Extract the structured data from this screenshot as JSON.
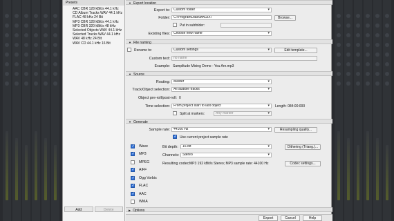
{
  "presets": {
    "title": "Presets",
    "items": [
      "AAC CBR 128 kBit/s 44.1 kHz",
      "CD Album Tracks WAV 44.1 kHz",
      "FLAC 48 kHz 24 Bit",
      "MP3 CBR 128 kBit/s 44.1 kHz",
      "MP3 CBR 320 kBit/s 48 kHz",
      "Selected Objects WAV 44.1 kHz",
      "Selected Tracks WAV 44.1 kHz",
      "WAV 48 kHz 24 Bit",
      "WAV CD 44.1 kHz 16 Bit"
    ],
    "add_label": "Add",
    "delete_label": "Delete"
  },
  "export_location": {
    "title": "Export location",
    "export_to_label": "Export to:",
    "export_to_value": "Custom folder",
    "folder_label": "Folder:",
    "folder_value": "C:\\ProgramData\\MAGIX\\",
    "browse_label": "Browse...",
    "subfolder_label": "Put in subfolder:",
    "existing_label": "Existing files:",
    "existing_value": "Choose new name"
  },
  "file_naming": {
    "title": "File naming",
    "rename_label": "Rename to:",
    "rename_value": "Custom settings",
    "edit_template_label": "Edit template...",
    "custom_text_label": "Custom text:",
    "custom_text_placeholder": "no name",
    "example_label": "Example:",
    "example_value": "Samplitude Mixing Demo - You Are.mp3"
  },
  "source": {
    "title": "Source",
    "routing_label": "Routing:",
    "routing_value": "Master",
    "track_label": "Track/Object selection:",
    "track_value": "All audible tracks",
    "preroll_label": "Object pre-roll/post-roll:",
    "preroll_value": "0",
    "time_label": "Time selection:",
    "time_value": "From project start to last object",
    "length_label": "Length: 084:00:000",
    "split_label": "Split at markers:",
    "split_value": "Any marker"
  },
  "generate": {
    "title": "Generate",
    "sample_rate_label": "Sample rate:",
    "sample_rate_value": "44100 Hz",
    "resampling_label": "Resampling quality...",
    "use_current_label": "Use current project sample rate",
    "formats": [
      {
        "name": "Wave",
        "checked": true
      },
      {
        "name": "MP3",
        "checked": true
      },
      {
        "name": "MPEG",
        "checked": false
      },
      {
        "name": "AIFF",
        "checked": true
      },
      {
        "name": "Ogg Vorbis",
        "checked": true
      },
      {
        "name": "FLAC",
        "checked": true
      },
      {
        "name": "AAC",
        "checked": true
      },
      {
        "name": "WMA",
        "checked": false
      }
    ],
    "bit_depth_label": "Bit depth:",
    "bit_depth_value": "16-bit",
    "dithering_label": "Dithering (Triang.)...",
    "channels_label": "Channels:",
    "channels_value": "Stereo",
    "codec_label": "Resulting codec:",
    "codec_value": "MP3 192 kBit/s Stereo; MP3 sample rate: 44100 Hz",
    "codec_settings_label": "Codec settings..."
  },
  "options": {
    "title": "Options"
  },
  "footer": {
    "export_label": "Export",
    "cancel_label": "Cancel",
    "help_label": "Help"
  },
  "colors": {
    "accent": "#2f6fd6",
    "dialog_bg": "#ececec",
    "mixer_bg": "#2a2d31"
  }
}
